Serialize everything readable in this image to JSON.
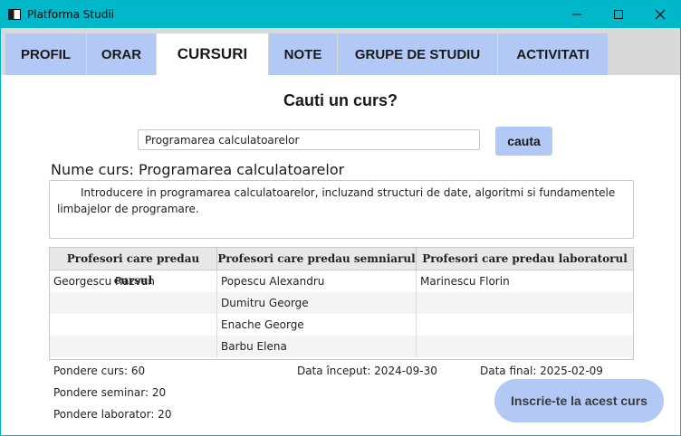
{
  "window": {
    "title": "Platforma Studii"
  },
  "tabs": [
    {
      "label": "PROFIL"
    },
    {
      "label": "ORAR"
    },
    {
      "label": "CURSURI"
    },
    {
      "label": "NOTE"
    },
    {
      "label": "GRUPE DE STUDIU"
    },
    {
      "label": "ACTIVITATI"
    }
  ],
  "active_tab": "CURSURI",
  "main": {
    "heading": "Cauti un curs?",
    "search": {
      "value": "Programarea calculatoarelor",
      "button_label": "cauta"
    },
    "course_name": "Nume curs: Programarea calculatoarelor",
    "description": "Introducere in programarea calculatoarelor, incluzand structuri de date, algoritmi si fundamentele limbajelor de programare.",
    "table": {
      "headers": [
        "Profesori care predau cursul",
        "Profesori care predau semniarul",
        "Profesori care predau laboratorul"
      ],
      "rows": [
        [
          "Georgescu Razvan",
          "Popescu Alexandru",
          "Marinescu Florin"
        ],
        [
          "",
          "Dumitru George",
          ""
        ],
        [
          "",
          "Enache George",
          ""
        ],
        [
          "",
          "Barbu Elena",
          ""
        ]
      ]
    },
    "weights": {
      "curs": "Pondere curs: 60",
      "seminar": "Pondere seminar: 20",
      "laborator": "Pondere laborator: 20"
    },
    "dates": {
      "start": "Data început: 2024-09-30",
      "end": "Data final: 2025-02-09"
    },
    "enroll_button": "Inscrie-te la acest curs"
  },
  "colors": {
    "titlebar": "#00b8c9",
    "tab": "#b3c9f5",
    "button": "#b3c9f5"
  }
}
